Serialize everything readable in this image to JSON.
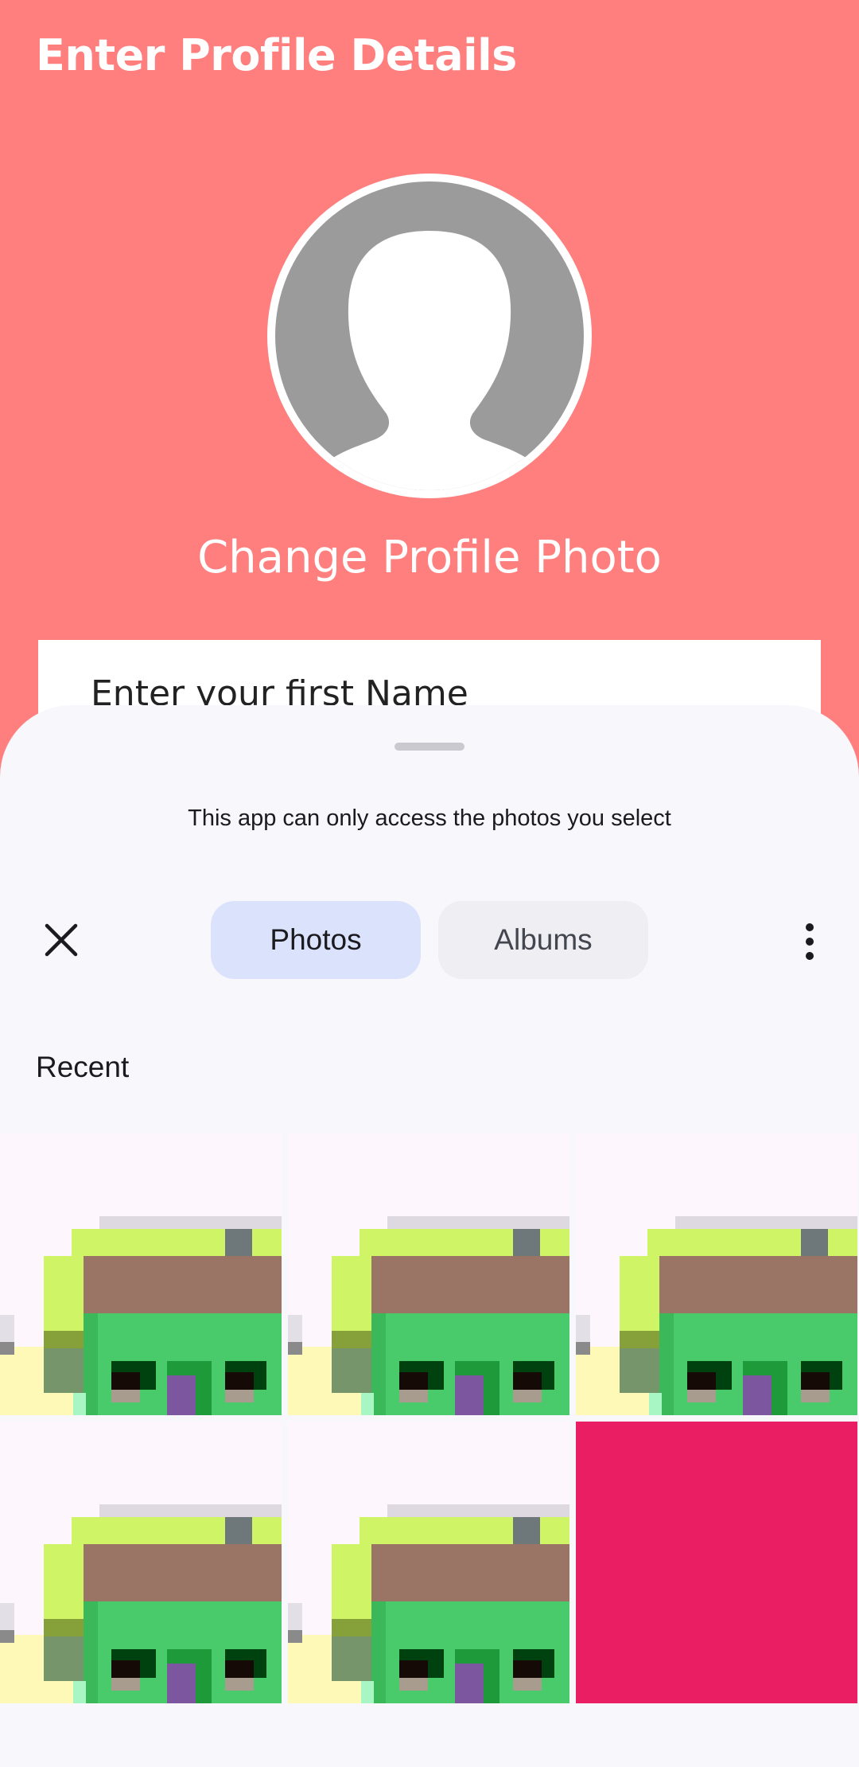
{
  "header": {
    "title": "Enter Profile Details"
  },
  "profile": {
    "change_photo_label": "Change Profile Photo"
  },
  "form": {
    "first_name_placeholder": "Enter your first Name"
  },
  "picker": {
    "notice": "This app can only access the photos you select",
    "tabs": [
      {
        "label": "Photos",
        "selected": true
      },
      {
        "label": "Albums",
        "selected": false
      }
    ],
    "section_title": "Recent",
    "photos": [
      {
        "kind": "house"
      },
      {
        "kind": "house"
      },
      {
        "kind": "house"
      },
      {
        "kind": "house"
      },
      {
        "kind": "house"
      },
      {
        "kind": "solid",
        "color": "#E91E63"
      }
    ]
  },
  "colors": {
    "header_bg": "#FF7F7F",
    "sheet_bg": "#F7F7FC",
    "selected_tab": "#DBE2FC",
    "unselected_tab": "#EEEEF3"
  }
}
